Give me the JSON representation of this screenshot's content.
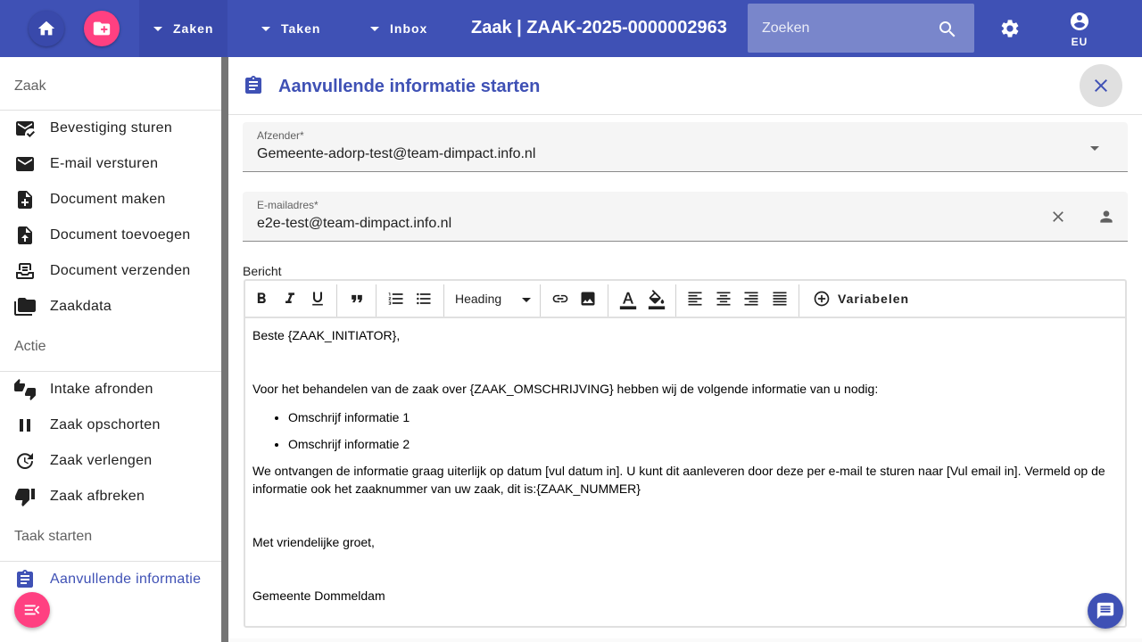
{
  "topbar": {
    "nav": [
      "Zaken",
      "Taken",
      "Inbox"
    ],
    "title": "Zaak | ZAAK-2025-0000002963",
    "search_placeholder": "Zoeken",
    "user_initials": "EU"
  },
  "sidebar": {
    "sections": [
      {
        "title": "Zaak",
        "items": [
          {
            "label": "Bevestiging sturen",
            "icon": "mark-email-read-icon"
          },
          {
            "label": "E-mail versturen",
            "icon": "email-icon"
          },
          {
            "label": "Document maken",
            "icon": "note-add-icon"
          },
          {
            "label": "Document toevoegen",
            "icon": "upload-file-icon"
          },
          {
            "label": "Document verzenden",
            "icon": "send-document-icon"
          },
          {
            "label": "Zaakdata",
            "icon": "folder-icon"
          }
        ]
      },
      {
        "title": "Actie",
        "items": [
          {
            "label": "Intake afronden",
            "icon": "thumbs-up-down-icon"
          },
          {
            "label": "Zaak opschorten",
            "icon": "pause-icon"
          },
          {
            "label": "Zaak verlengen",
            "icon": "update-icon"
          },
          {
            "label": "Zaak afbreken",
            "icon": "thumb-down-icon"
          }
        ]
      },
      {
        "title": "Taak starten",
        "items": [
          {
            "label": "Aanvullende informatie",
            "icon": "assignment-icon"
          }
        ]
      }
    ]
  },
  "panel": {
    "title": "Aanvullende informatie starten",
    "afzender": {
      "label": "Afzender*",
      "value": "Gemeente-adorp-test@team-dimpact.info.nl"
    },
    "emailadres": {
      "label": "E-mailadres*",
      "value": "e2e-test@team-dimpact.info.nl"
    },
    "bericht_label": "Bericht",
    "toolbar": {
      "heading": "Heading",
      "variabelen": "Variabelen"
    },
    "body": {
      "greeting": "Beste {ZAAK_INITIATOR},",
      "intro": "Voor het behandelen van de zaak over {ZAAK_OMSCHRIJVING} hebben wij de volgende informatie van u nodig:",
      "bullets": [
        "Omschrijf informatie 1",
        "Omschrijf informatie 2"
      ],
      "paragraph": "We ontvangen de informatie graag uiterlijk op datum [vul datum in]. U kunt dit aanleveren door deze per e-mail te sturen naar [Vul email in]. Vermeld op de informatie ook het zaaknummer van uw zaak, dit is:{ZAAK_NUMMER}",
      "closing": "Met vriendelijke groet,",
      "signature": "Gemeente Dommeldam"
    }
  },
  "colors": {
    "primary": "#3f51b5",
    "accent": "#ff4081"
  }
}
